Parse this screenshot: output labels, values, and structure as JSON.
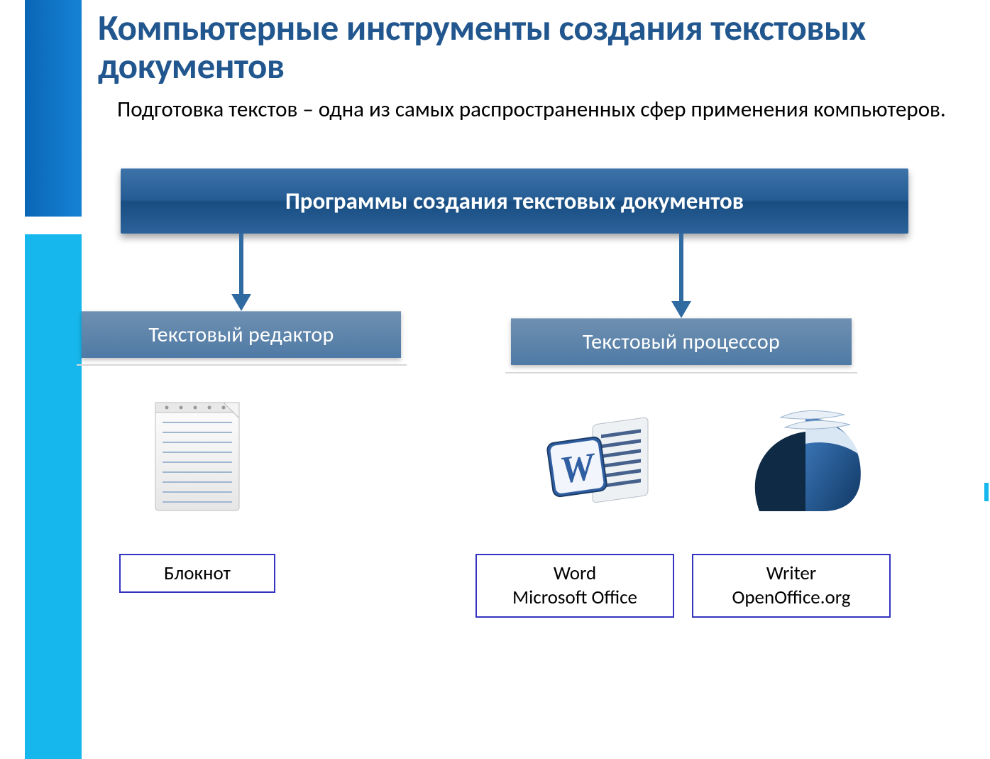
{
  "title": "Компьютерные инструменты создания текстовых документов",
  "lead": "Подготовка текстов – одна из самых распространенных сфер применения компьютеров.",
  "banner": "Программы создания текстовых документов",
  "branches": {
    "left": {
      "heading": "Текстовый редактор"
    },
    "right": {
      "heading": "Текстовый процессор"
    }
  },
  "apps": {
    "notepad": {
      "line1": "Блокнот"
    },
    "word": {
      "line1": "Word",
      "line2": "Microsoft Office"
    },
    "writer": {
      "line1": "Writer",
      "line2": "OpenOffice.org"
    }
  },
  "icons": {
    "notepad": "notepad-icon",
    "word": "msword-icon",
    "openoffice": "openoffice-icon"
  }
}
